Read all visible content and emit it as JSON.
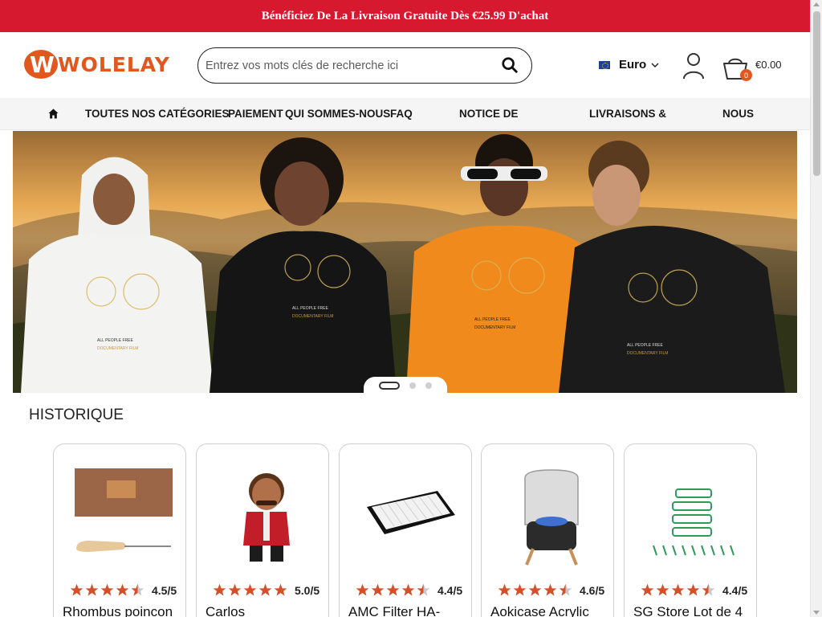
{
  "promo": {
    "text": "Bénéficiez De La Livraison Gratuite Dès €25.99 D'achat"
  },
  "header": {
    "logo_text": "WOLELAY",
    "logo_letter": "W",
    "search_placeholder": "Entrez vos mots clés de recherche ici",
    "currency": "Euro",
    "cart_count": "0",
    "cart_total": "€0.00"
  },
  "nav": {
    "items": [
      {
        "label": "TOUTES NOS CATÉGORIES"
      },
      {
        "label": "PAIEMENT"
      },
      {
        "label": "QUI SOMMES-NOUS"
      },
      {
        "label": "FAQ"
      },
      {
        "label": "NOTICE DE"
      },
      {
        "label": "LIVRAISONS &"
      },
      {
        "label": "NOUS"
      }
    ]
  },
  "banner": {
    "slide_count": 3,
    "active_slide": 1,
    "shirt_caption": "ALL PEOPLE FREE",
    "shirt_subcaption": "DOCUMENTARY FILM"
  },
  "section": {
    "title": "HISTORIQUE"
  },
  "products": [
    {
      "rating_text": "4.5/5",
      "rating": 4.5,
      "title": "Rhombus poincon"
    },
    {
      "rating_text": "5.0/5",
      "rating": 5.0,
      "title": "Carlos"
    },
    {
      "rating_text": "4.4/5",
      "rating": 4.4,
      "title": "AMC Filter HA-"
    },
    {
      "rating_text": "4.6/5",
      "rating": 4.6,
      "title": "Aokicase Acrylic"
    },
    {
      "rating_text": "4.4/5",
      "rating": 4.4,
      "title": "SG Store Lot de 4"
    }
  ],
  "colors": {
    "accent": "#e2571e",
    "promo_bg": "#d7192f",
    "star": "#d4502a",
    "star_empty": "#c8c8c8"
  }
}
